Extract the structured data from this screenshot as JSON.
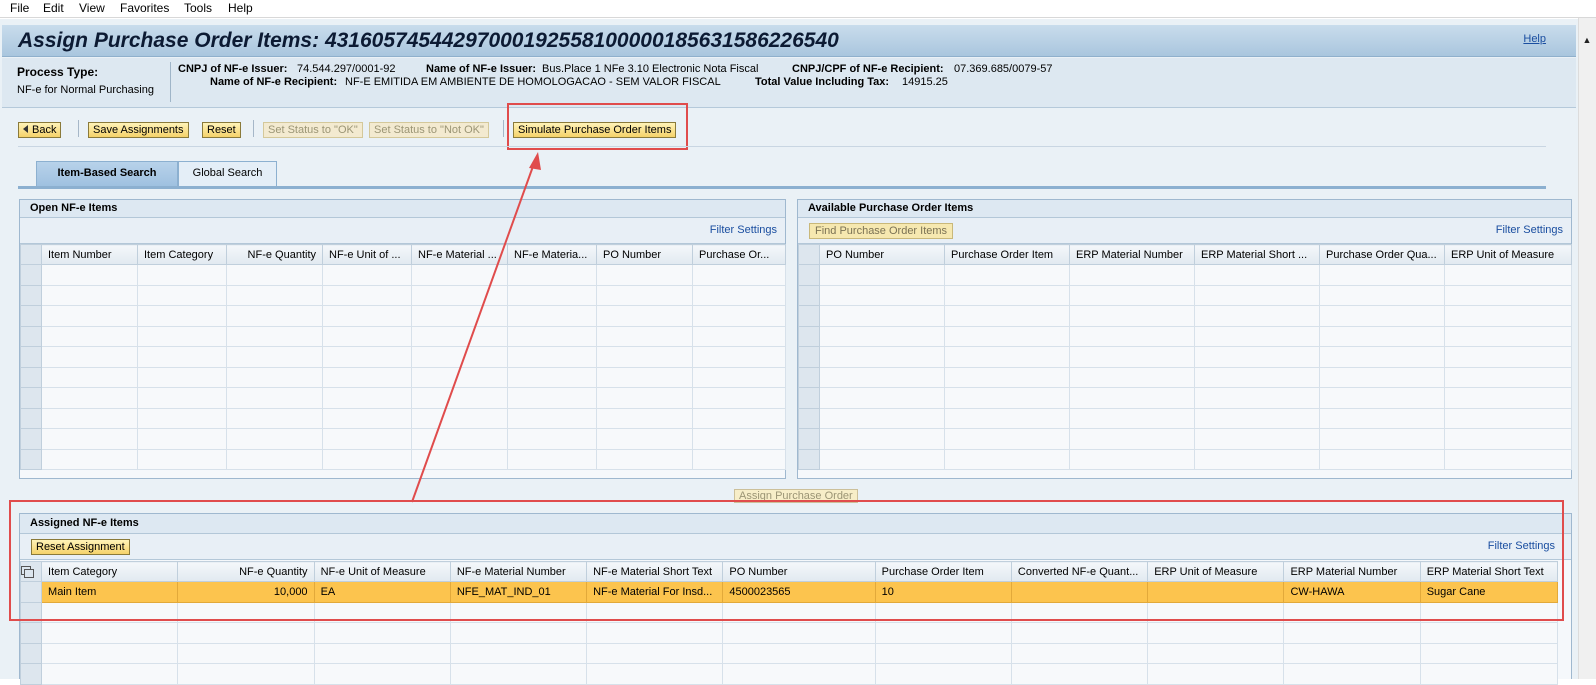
{
  "menu": [
    "File",
    "Edit",
    "View",
    "Favorites",
    "Tools",
    "Help"
  ],
  "page": {
    "title": "Assign Purchase Order Items: 43160574544297000192558100000185631586226540",
    "help_link": "Help"
  },
  "info": {
    "process_type_label": "Process Type:",
    "process_type_value": "NF-e for Normal Purchasing",
    "cnpj_issuer_label": "CNPJ of NF-e Issuer:",
    "cnpj_issuer_value": "74.544.297/0001-92",
    "issuer_name_label": "Name of NF-e Issuer:",
    "issuer_name_value": "Bus.Place 1 NFe 3.10 Electronic Nota Fiscal",
    "cnpj_recipient_label": "CNPJ/CPF of NF-e Recipient:",
    "cnpj_recipient_value": "07.369.685/0079-57",
    "recipient_name_label": "Name of NF-e Recipient:",
    "recipient_name_value": "NF-E EMITIDA EM AMBIENTE DE HOMOLOGACAO - SEM VALOR FISCAL",
    "total_label": "Total Value Including Tax:",
    "total_value": "14915.25"
  },
  "toolbar": {
    "back": "Back",
    "save": "Save Assignments",
    "reset": "Reset",
    "set_ok": "Set Status to \"OK\"",
    "set_not_ok": "Set Status to \"Not OK\"",
    "simulate": "Simulate Purchase Order Items"
  },
  "tabs": [
    "Item-Based Search",
    "Global Search"
  ],
  "open_items": {
    "title": "Open NF-e Items",
    "filter": "Filter Settings",
    "columns": [
      "Item Number",
      "Item Category",
      "NF-e Quantity",
      "NF-e Unit of ...",
      "NF-e Material ...",
      "NF-e Materia...",
      "PO Number",
      "Purchase Or..."
    ]
  },
  "available_items": {
    "title": "Available Purchase Order Items",
    "find_button": "Find Purchase Order Items",
    "filter": "Filter Settings",
    "columns": [
      "PO Number",
      "Purchase Order Item",
      "ERP Material Number",
      "ERP Material Short ...",
      "Purchase Order Qua...",
      "ERP Unit of Measure"
    ]
  },
  "assign_po_button": "Assign Purchase Order",
  "assigned_items": {
    "title": "Assigned NF-e Items",
    "reset_button": "Reset Assignment",
    "filter": "Filter Settings",
    "columns": [
      "Item Category",
      "NF-e Quantity",
      "NF-e Unit of Measure",
      "NF-e Material Number",
      "NF-e Material Short Text",
      "PO Number",
      "Purchase Order Item",
      "Converted NF-e Quant...",
      "ERP Unit of Measure",
      "ERP Material Number",
      "ERP Material Short Text"
    ],
    "rows": [
      [
        "Main Item",
        "10,000",
        "EA",
        "NFE_MAT_IND_01",
        "NF-e Material For Insd...",
        "4500023565",
        "10",
        "",
        "",
        "CW-HAWA",
        "Sugar Cane"
      ]
    ]
  },
  "colors": {
    "highlight_row": "#fcc44e",
    "annotation": "#e04c4c",
    "link": "#1a4ea0"
  },
  "icons": [
    "arrow-left-icon",
    "copy-icon",
    "scroll-up-icon"
  ]
}
